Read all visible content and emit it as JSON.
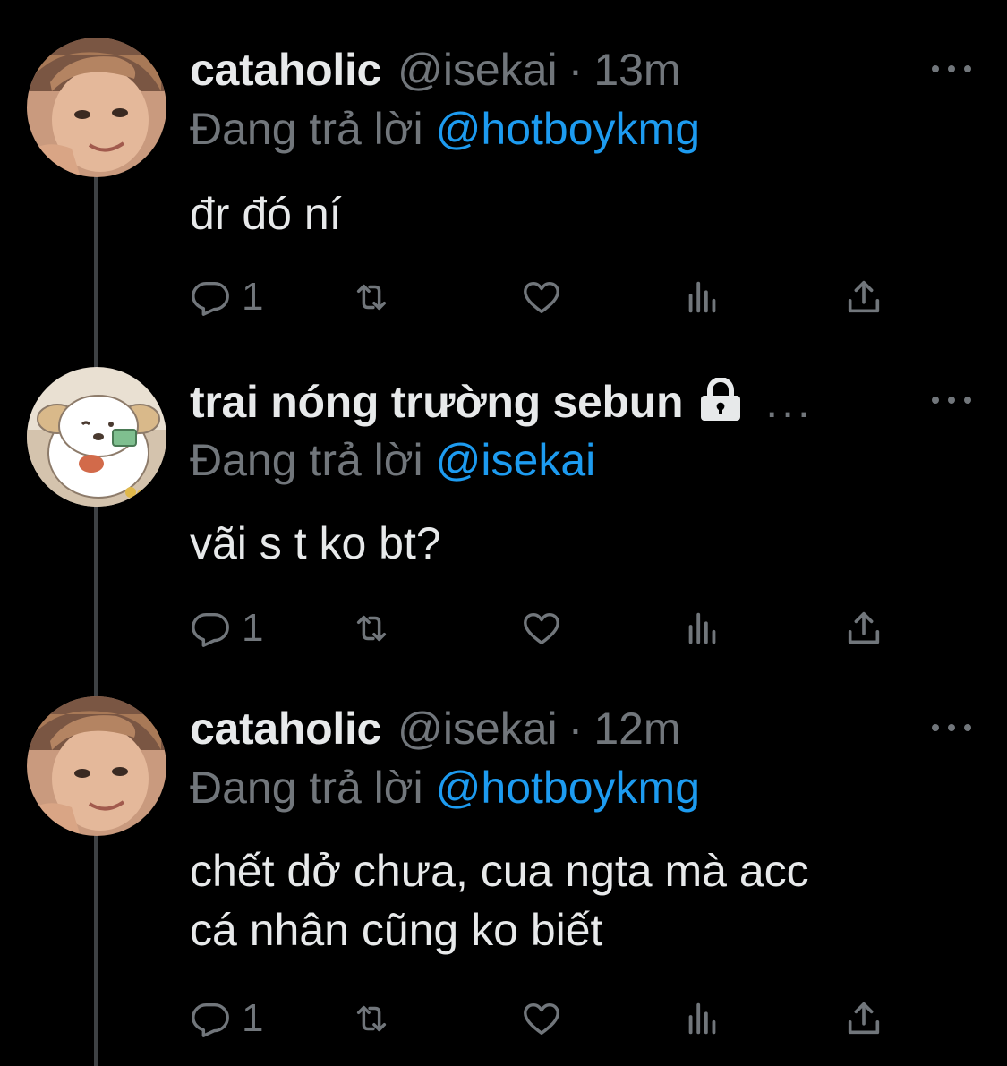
{
  "thread": [
    {
      "author": {
        "name": "cataholic",
        "handle": "@isekai",
        "avatar": "man-photo-avatar",
        "locked": false,
        "truncated": false
      },
      "time": "13m",
      "reply_prefix": "Đang trả lời",
      "reply_to": "@hotboykmg",
      "text_lines": [
        "đr đó ní"
      ],
      "stats": {
        "replies": "1",
        "retweets": "",
        "likes": "",
        "views": ""
      }
    },
    {
      "author": {
        "name": "trai nóng trường sebun",
        "handle": "",
        "avatar": "dog-cartoon-avatar",
        "locked": true,
        "truncated": true,
        "truncation": "..."
      },
      "time": "",
      "reply_prefix": "Đang trả lời",
      "reply_to": "@isekai",
      "text_lines": [
        "vãi s t ko bt?"
      ],
      "stats": {
        "replies": "1",
        "retweets": "",
        "likes": "",
        "views": ""
      }
    },
    {
      "author": {
        "name": "cataholic",
        "handle": "@isekai",
        "avatar": "man-photo-avatar",
        "locked": false,
        "truncated": false
      },
      "time": "12m",
      "reply_prefix": "Đang trả lời",
      "reply_to": "@hotboykmg",
      "text_lines": [
        "chết dở chưa, cua ngta mà acc",
        "cá nhân cũng ko biết"
      ],
      "stats": {
        "replies": "1",
        "retweets": "",
        "likes": "",
        "views": ""
      }
    }
  ],
  "separator": "·",
  "icons": {
    "reply": "reply-icon",
    "retweet": "retweet-icon",
    "like": "heart-icon",
    "views": "views-bar-icon",
    "share": "share-icon",
    "more": "more-dots-icon",
    "lock": "lock-icon"
  },
  "colors": {
    "background": "#000000",
    "text": "#e7e9ea",
    "secondary": "#71767b",
    "link": "#1d9bf0",
    "thread_line": "#3e4144"
  }
}
